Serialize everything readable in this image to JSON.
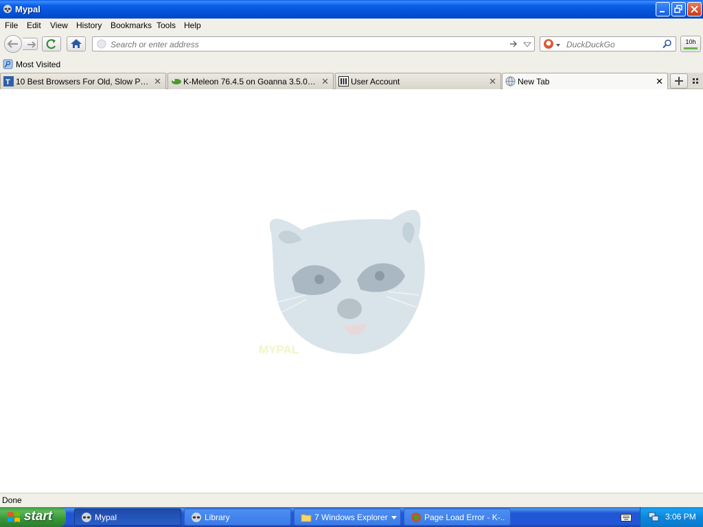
{
  "window": {
    "title": "Mypal"
  },
  "menu": [
    "File",
    "Edit",
    "View",
    "History",
    "Bookmarks",
    "Tools",
    "Help"
  ],
  "nav": {
    "url_placeholder": "Search or enter address",
    "search_placeholder": "DuckDuckGo",
    "badge": "10h"
  },
  "bookmarks": [
    {
      "label": "Most Visited"
    }
  ],
  "tabs": [
    {
      "label": "10 Best Browsers For Old, Slow PCs in ...",
      "active": false
    },
    {
      "label": "K-Meleon 76.4.5 on Goanna 3.5.0 (Buil...",
      "active": false
    },
    {
      "label": "User Account",
      "active": false
    },
    {
      "label": "New Tab",
      "active": true
    }
  ],
  "status": {
    "text": "Done"
  },
  "taskbar": {
    "start_label": "start",
    "tasks": [
      {
        "label": "Mypal",
        "active": true
      },
      {
        "label": "Library",
        "active": false
      },
      {
        "label": "7 Windows Explorer",
        "active": false
      },
      {
        "label": "Page Load Error - K-...",
        "active": false
      }
    ],
    "clock": "3:06 PM"
  },
  "colors": {
    "titlebar": "#0a5ee6",
    "taskbar": "#2157d7",
    "start": "#37963a",
    "tray": "#0c87de"
  }
}
